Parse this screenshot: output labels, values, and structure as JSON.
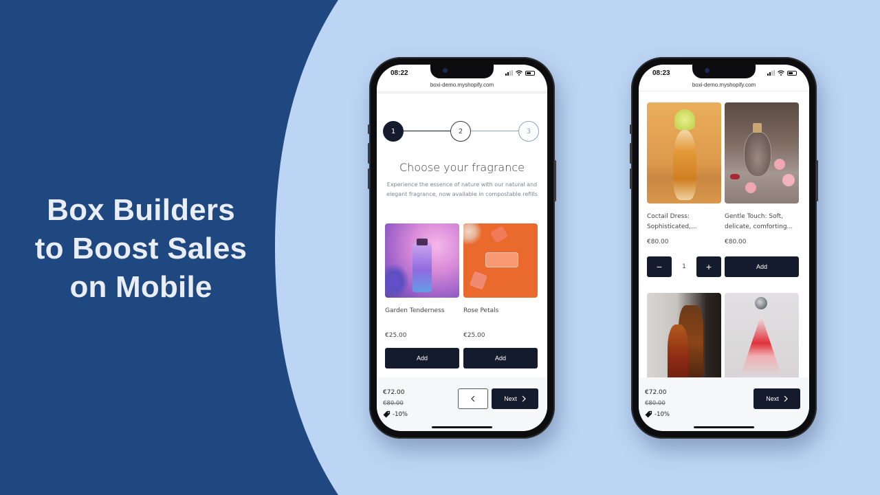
{
  "headline": {
    "lines": [
      "Box Builders",
      "to Boost Sales",
      "on Mobile"
    ]
  },
  "colors": {
    "background_dark": "#1f4780",
    "background_light": "#bcd5f5",
    "button_dark": "#141b2d",
    "headline_text": "#e9eef6"
  },
  "phone_left": {
    "status": {
      "time": "08:22"
    },
    "url": "boxi-demo.myshopify.com",
    "stepper": {
      "steps": [
        {
          "label": "1",
          "state": "active"
        },
        {
          "label": "2",
          "state": "next"
        },
        {
          "label": "3",
          "state": "upcoming"
        }
      ]
    },
    "title": "Choose your fragrance",
    "subtitle": "Experience the essence of nature with our natural and elegant fragrance, now available in compostable refills",
    "products": [
      {
        "name": "Garden Tenderness",
        "price": "€25.00",
        "button": "Add",
        "image": "purple-perfume-bottle-lavender"
      },
      {
        "name": "Rose Petals",
        "price": "€25.00",
        "button": "Add",
        "image": "glass-bottles-orange-background"
      }
    ],
    "footer": {
      "total": "€72.00",
      "original": "€80.00",
      "discount": "-10%",
      "back_icon": "chevron-left-icon",
      "next_label": "Next",
      "next_icon": "chevron-right-icon"
    }
  },
  "phone_right": {
    "status": {
      "time": "08:23"
    },
    "url": "boxi-demo.myshopify.com",
    "products": [
      {
        "name": "Coctail Dress: Sophisticated,...",
        "price": "€80.00",
        "image": "amber-perfume-flower-cap"
      },
      {
        "name": "Gentle Touch: Soft, delicate, comforting...",
        "price": "€80.00",
        "image": "perfume-with-pink-pompoms"
      },
      {
        "name": "",
        "price": "",
        "image": "brown-glass-bottles"
      },
      {
        "name": "",
        "price": "",
        "image": "pyramid-bottle-red-ink"
      }
    ],
    "quantity": {
      "minus_label": "−",
      "value": "1",
      "plus_label": "+",
      "add_label": "Add"
    },
    "footer": {
      "total": "€72.00",
      "original": "€80.00",
      "discount": "-10%",
      "next_label": "Next",
      "next_icon": "chevron-right-icon"
    }
  }
}
